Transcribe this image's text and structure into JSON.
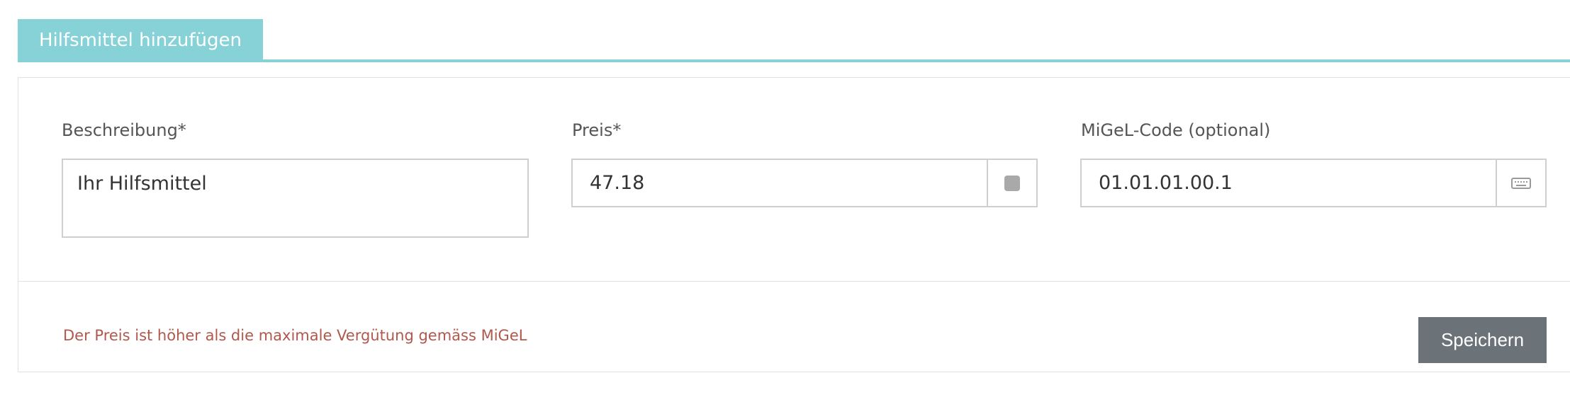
{
  "tab": {
    "label": "Hilfsmittel hinzufügen"
  },
  "form": {
    "beschreibung": {
      "label": "Beschreibung*",
      "value": "Ihr Hilfsmittel"
    },
    "preis": {
      "label": "Preis*",
      "value": "47.18",
      "addon_icon": "square-icon"
    },
    "migel": {
      "label": "MiGeL-Code (optional)",
      "value": "01.01.01.00.1",
      "addon_icon": "keyboard-icon"
    }
  },
  "footer": {
    "warning": "Der Preis ist höher als die maximale Vergütung gemäss MiGeL",
    "save_label": "Speichern"
  },
  "colors": {
    "accent": "#86d2d7",
    "warning": "#b0584d",
    "button": "#6b7378"
  }
}
